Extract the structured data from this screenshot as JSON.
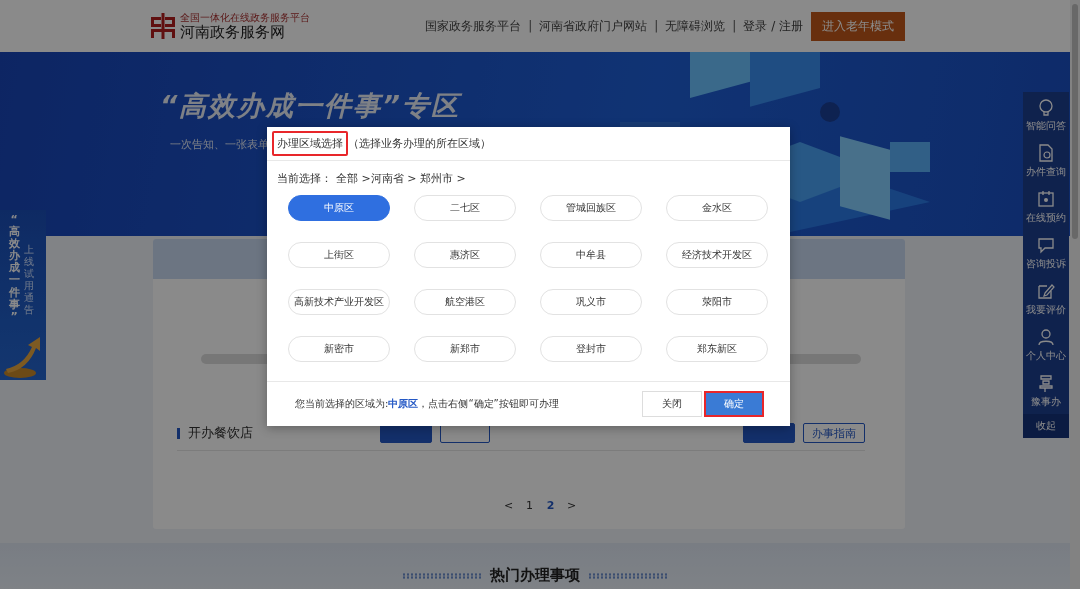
{
  "header": {
    "logo_tagline": "全国一体化在线政务服务平台",
    "logo_title": "河南政务服务网",
    "links": [
      {
        "label": "国家政务服务平台",
        "separator": "|"
      },
      {
        "label": "河南省政府门户网站",
        "separator": "|"
      },
      {
        "label": "无障碍浏览",
        "separator": "|"
      }
    ],
    "login": "登录 / 注册",
    "elder_button": "进入老年模式"
  },
  "banner": {
    "title": "“高效办成一件事”专区",
    "subtitle": "一次告知、一张表单"
  },
  "float_banner": {
    "title": "“高效办成一件事”",
    "subtitle": "上线试用通告"
  },
  "side_nav": {
    "items": [
      {
        "label": "智能问答",
        "kind": "bulb"
      },
      {
        "label": "办件查询",
        "kind": "doc-search"
      },
      {
        "label": "在线预约",
        "kind": "calendar"
      },
      {
        "label": "咨询投诉",
        "kind": "message"
      },
      {
        "label": "我要评价",
        "kind": "edit"
      },
      {
        "label": "个人中心",
        "kind": "person"
      },
      {
        "label": "豫事办",
        "kind": "mark"
      }
    ],
    "collapse": "收起"
  },
  "content": {
    "rows": [
      {
        "title": "开办餐饮店"
      }
    ],
    "guide_button": "办事指南",
    "pagination": [
      {
        "label": "<",
        "selected": false
      },
      {
        "label": "1",
        "selected": false
      },
      {
        "label": "2",
        "selected": true
      },
      {
        "label": ">",
        "selected": false
      }
    ]
  },
  "hot_section": {
    "title": "热门办理事项"
  },
  "modal": {
    "title": "办理区域选择",
    "title_highlighted": true,
    "hint": "（选择业务办理的所在区域）",
    "breadcrumb_label": "当前选择：",
    "breadcrumb": "全部 >河南省 > 郑州市 >",
    "regions": [
      {
        "label": "中原区",
        "selected": true
      },
      {
        "label": "二七区",
        "selected": false
      },
      {
        "label": "管城回族区",
        "selected": false
      },
      {
        "label": "金水区",
        "selected": false
      },
      {
        "label": "上街区",
        "selected": false
      },
      {
        "label": "惠济区",
        "selected": false
      },
      {
        "label": "中牟县",
        "selected": false
      },
      {
        "label": "经济技术开发区",
        "selected": false
      },
      {
        "label": "高新技术产业开发区",
        "selected": false
      },
      {
        "label": "航空港区",
        "selected": false
      },
      {
        "label": "巩义市",
        "selected": false
      },
      {
        "label": "荥阳市",
        "selected": false
      },
      {
        "label": "新密市",
        "selected": false
      },
      {
        "label": "新郑市",
        "selected": false
      },
      {
        "label": "登封市",
        "selected": false
      },
      {
        "label": "郑东新区",
        "selected": false
      }
    ],
    "footer_text": "您当前选择的区域为:**中原区**，点击右侧“确定”按钮即可办理",
    "buttons": [
      {
        "label": "关闭",
        "kind": "default",
        "highlighted": false
      },
      {
        "label": "确定",
        "kind": "primary",
        "highlighted": true
      }
    ]
  }
}
